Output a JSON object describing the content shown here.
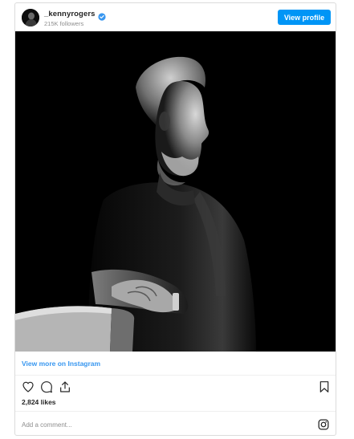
{
  "header": {
    "username": "_kennyrogers",
    "followers": "215K followers",
    "view_profile_label": "View profile"
  },
  "post": {
    "view_more_label": "View more on Instagram",
    "likes": "2,824 likes",
    "comment_placeholder": "Add a comment..."
  },
  "icons": {
    "verified": "verified-badge-icon",
    "like": "heart-icon",
    "comment": "comment-bubble-icon",
    "share": "share-icon",
    "save": "bookmark-icon",
    "instagram": "instagram-logo-icon"
  },
  "colors": {
    "accent": "#0095f6",
    "link": "#3897f0",
    "muted": "#8e8e8e",
    "border": "#dbdbdb"
  }
}
